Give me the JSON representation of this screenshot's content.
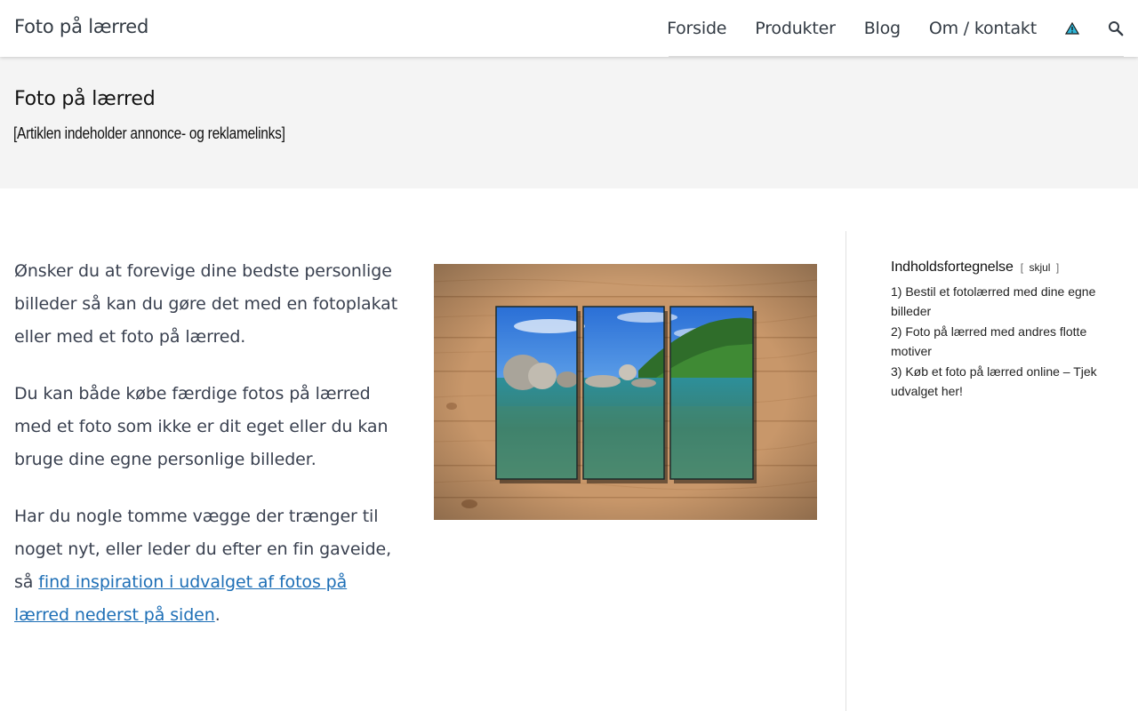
{
  "header": {
    "site_title": "Foto på lærred",
    "nav": [
      {
        "label": "Forside"
      },
      {
        "label": "Produkter"
      },
      {
        "label": "Blog"
      },
      {
        "label": "Om / kontakt"
      }
    ],
    "icons": [
      "warning-triangle-icon",
      "search-icon"
    ]
  },
  "banner": {
    "title": "Foto på lærred",
    "disclaimer": "[Artiklen indeholder annonce- og reklamelinks]"
  },
  "content": {
    "para1": "Ønsker du at forevige dine bedste personlige billeder så kan du gøre det med en fotoplakat eller med et foto på lærred.",
    "para2": "Du kan både købe færdige fotos på lærred med et foto som ikke er dit eget eller du kan bruge dine egne personlige billeder.",
    "para3_text": "Har du nogle tomme vægge der trænger til noget nyt, eller leder du efter en fin gaveide, så ",
    "para3_link": "find inspiration i udvalget af fotos på lærred nederst på siden",
    "para3_end": "."
  },
  "toc": {
    "title": "Indholdsfortegnelse",
    "toggle_open": "[",
    "toggle_label": "skjul",
    "toggle_close": "]",
    "items": [
      {
        "num": "1)",
        "label": "Bestil et fotolærred med dine egne billeder"
      },
      {
        "num": "2)",
        "label": "Foto på lærred med andres flotte motiver"
      },
      {
        "num": "3)",
        "label": "Køb et foto på lærred online – Tjek udvalget her!"
      }
    ]
  },
  "colors": {
    "link": "#1e6fb6",
    "text": "#3a4150",
    "banner_bg": "#f4f4f4",
    "wood": "#c8976a"
  }
}
